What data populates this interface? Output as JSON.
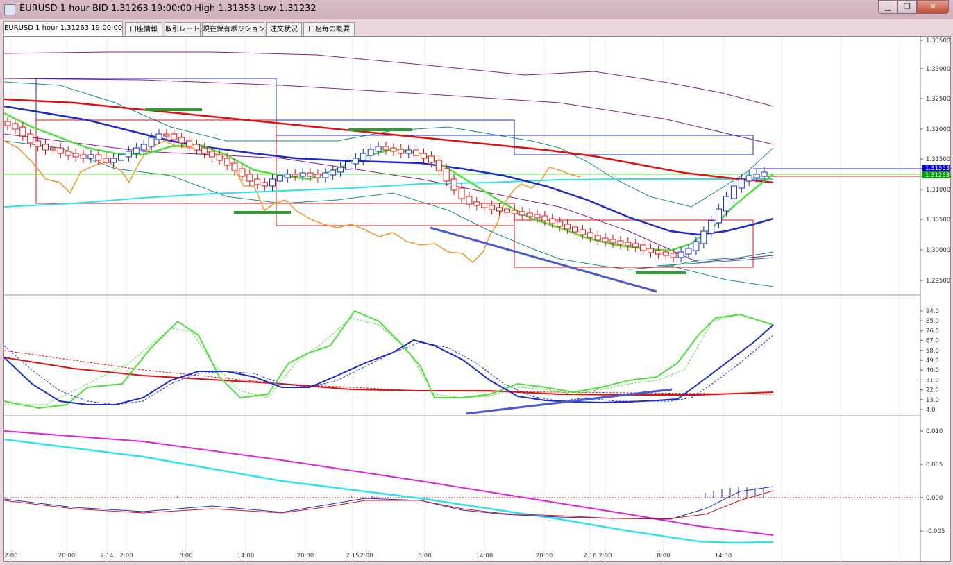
{
  "window": {
    "title": "EURUSD 1 hour BID 1.31263 19:00:00 High 1.31353 Low 1.31232",
    "controls": [
      "minimize",
      "restore",
      "close"
    ]
  },
  "tabs": [
    {
      "label": "EURUSD 1 hour 1.31263 19:00:00",
      "active": true
    },
    {
      "label": "口座情報",
      "active": false
    },
    {
      "label": "取引レート",
      "active": false
    },
    {
      "label": "現在保有ポジション",
      "active": false
    },
    {
      "label": "注文状況",
      "active": false
    },
    {
      "label": "口座毎の概要",
      "active": false
    }
  ],
  "price_panel": {
    "y_ticks": [
      "1.33500",
      "1.33000",
      "1.32500",
      "1.32000",
      "1.31500",
      "1.31000",
      "1.30500",
      "1.30000",
      "1.29500"
    ],
    "current_price_labels": [
      "1.31353",
      "1.31263"
    ],
    "current_price_colors": [
      "#0000cc",
      "#00a000"
    ]
  },
  "oscillator_panel": {
    "y_ticks": [
      "94.0",
      "85.0",
      "76.0",
      "67.0",
      "58.0",
      "49.0",
      "40.0",
      "31.0",
      "22.0",
      "13.0",
      "4.0"
    ]
  },
  "macd_panel": {
    "y_ticks": [
      "0.010",
      "0.005",
      "0.000",
      "-0.005"
    ]
  },
  "x_axis": {
    "labels": [
      "2:00",
      "20:00",
      "2.14",
      "2:00",
      "8:00",
      "14:00",
      "20:00",
      "2.15",
      "2:00",
      "8:00",
      "14:00",
      "20:00",
      "2.16",
      "2:00",
      "8:00",
      "14:00"
    ]
  },
  "colors": {
    "ma_red": "#e01010",
    "ma_blue": "#1a2bc8",
    "ma_green": "#4ce03a",
    "ma_cyan": "#2ee0f0",
    "orange_line": "#f09a30",
    "macd_magenta": "#e020e0"
  }
}
